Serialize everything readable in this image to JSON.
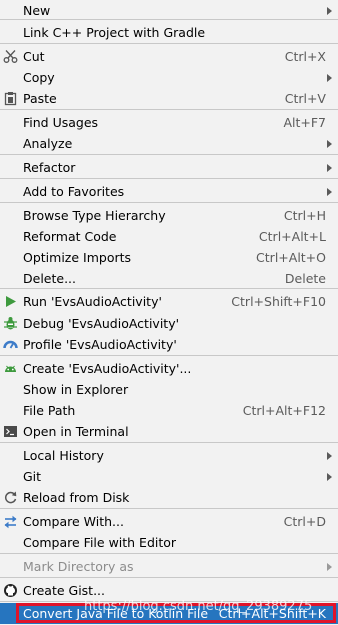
{
  "colors": {
    "menu_bg": "#f2f2f2",
    "separator": "#c8c8c8",
    "selected_bg": "#2675bf",
    "highlight_border": "#e0142a"
  },
  "menu": [
    {
      "label": "New",
      "submenu": true
    },
    {
      "label": "Link C++ Project with Gradle"
    },
    {
      "label": "Cut",
      "shortcut": "Ctrl+X",
      "icon": "scissors-icon"
    },
    {
      "label": "Copy",
      "submenu": true
    },
    {
      "label": "Paste",
      "shortcut": "Ctrl+V",
      "icon": "clipboard-icon"
    },
    {
      "label": "Find Usages",
      "shortcut": "Alt+F7"
    },
    {
      "label": "Analyze",
      "submenu": true
    },
    {
      "label": "Refactor",
      "submenu": true
    },
    {
      "label": "Add to Favorites",
      "submenu": true
    },
    {
      "label": "Browse Type Hierarchy",
      "shortcut": "Ctrl+H"
    },
    {
      "label": "Reformat Code",
      "shortcut": "Ctrl+Alt+L"
    },
    {
      "label": "Optimize Imports",
      "shortcut": "Ctrl+Alt+O"
    },
    {
      "label": "Delete...",
      "shortcut": "Delete"
    },
    {
      "label": "Run 'EvsAudioActivity'",
      "shortcut": "Ctrl+Shift+F10",
      "icon": "run-icon"
    },
    {
      "label": "Debug 'EvsAudioActivity'",
      "icon": "debug-icon"
    },
    {
      "label": "Profile 'EvsAudioActivity'",
      "icon": "profile-icon"
    },
    {
      "label": "Create 'EvsAudioActivity'...",
      "icon": "android-icon"
    },
    {
      "label": "Show in Explorer"
    },
    {
      "label": "File Path",
      "shortcut": "Ctrl+Alt+F12"
    },
    {
      "label": "Open in Terminal",
      "icon": "terminal-icon"
    },
    {
      "label": "Local History",
      "submenu": true
    },
    {
      "label": "Git",
      "submenu": true
    },
    {
      "label": "Reload from Disk",
      "icon": "reload-icon"
    },
    {
      "label": "Compare With...",
      "shortcut": "Ctrl+D",
      "icon": "compare-icon"
    },
    {
      "label": "Compare File with Editor"
    },
    {
      "label": "Mark Directory as",
      "submenu": true,
      "disabled": true
    },
    {
      "label": "Create Gist...",
      "icon": "github-icon"
    },
    {
      "label": "Convert Java File to Kotlin File",
      "shortcut": "Ctrl+Alt+Shift+K",
      "selected": true
    }
  ],
  "watermark": "https://blog.csdn.net/qq_29389275"
}
